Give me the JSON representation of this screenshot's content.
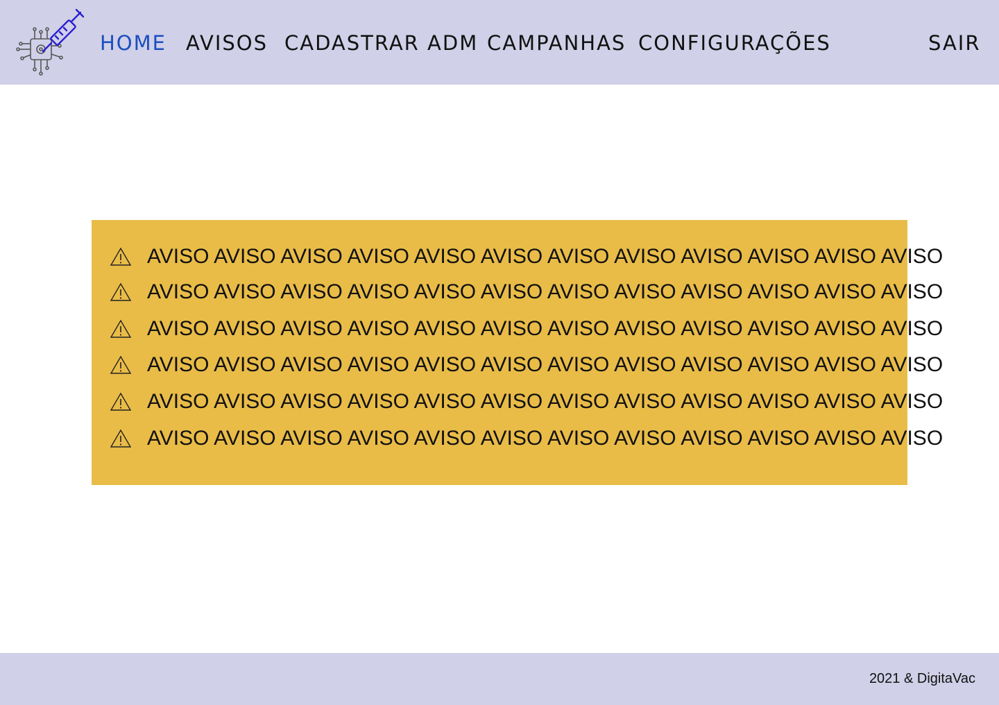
{
  "brand": {
    "logo_icon": "syringe-chip-icon",
    "accent_color": "#1b4fbf",
    "header_bg": "#d0d0e8",
    "warning_bg": "#e9bc48"
  },
  "nav": {
    "home": "HOME",
    "avisos": "AVISOS",
    "cadastrar_adm": "CADASTRAR ADM",
    "campanhas": "CAMPANHAS",
    "configuracoes": "CONFIGURAÇÕES",
    "sair": "SAIR"
  },
  "warnings": {
    "icon": "warning-triangle-icon",
    "items": [
      "AVISO AVISO AVISO AVISO AVISO AVISO AVISO AVISO AVISO AVISO AVISO AVISO",
      "AVISO AVISO AVISO AVISO AVISO AVISO AVISO AVISO AVISO AVISO AVISO AVISO",
      "AVISO AVISO AVISO AVISO AVISO AVISO AVISO AVISO AVISO AVISO AVISO AVISO",
      "AVISO AVISO AVISO AVISO AVISO AVISO AVISO AVISO AVISO AVISO AVISO AVISO",
      "AVISO AVISO AVISO AVISO AVISO AVISO AVISO AVISO AVISO AVISO AVISO AVISO",
      "AVISO AVISO AVISO AVISO AVISO AVISO AVISO AVISO AVISO AVISO AVISO AVISO"
    ]
  },
  "footer": {
    "text": "2021 & DigitaVac"
  }
}
